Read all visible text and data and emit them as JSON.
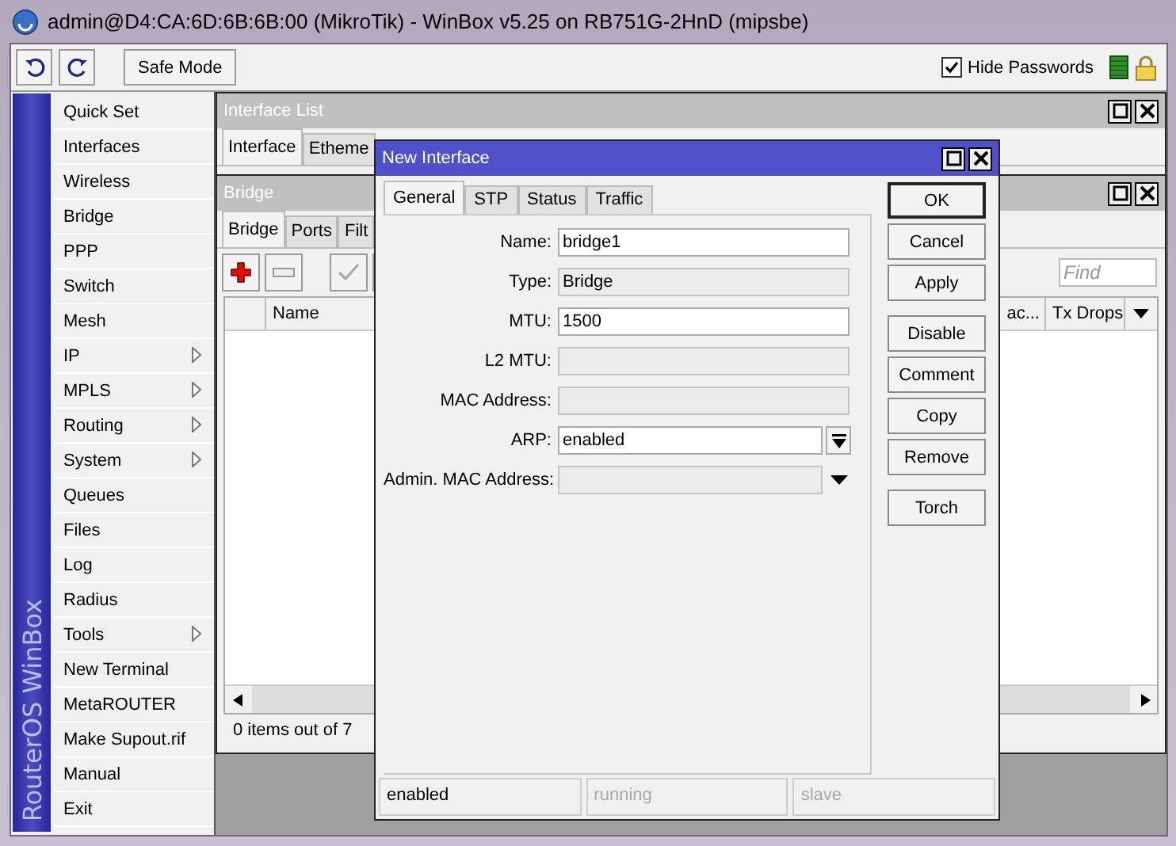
{
  "window": {
    "title": "admin@D4:CA:6D:6B:6B:00 (MikroTik) - WinBox v5.25 on RB751G-2HnD (mipsbe)"
  },
  "toolbar": {
    "safe_mode": "Safe Mode",
    "hide_passwords": {
      "label": "Hide Passwords",
      "checked": true
    }
  },
  "sidebar": {
    "brand": "RouterOS WinBox",
    "items": [
      {
        "label": "Quick Set",
        "submenu": false
      },
      {
        "label": "Interfaces",
        "submenu": false
      },
      {
        "label": "Wireless",
        "submenu": false
      },
      {
        "label": "Bridge",
        "submenu": false
      },
      {
        "label": "PPP",
        "submenu": false
      },
      {
        "label": "Switch",
        "submenu": false
      },
      {
        "label": "Mesh",
        "submenu": false
      },
      {
        "label": "IP",
        "submenu": true
      },
      {
        "label": "MPLS",
        "submenu": true
      },
      {
        "label": "Routing",
        "submenu": true
      },
      {
        "label": "System",
        "submenu": true
      },
      {
        "label": "Queues",
        "submenu": false
      },
      {
        "label": "Files",
        "submenu": false
      },
      {
        "label": "Log",
        "submenu": false
      },
      {
        "label": "Radius",
        "submenu": false
      },
      {
        "label": "Tools",
        "submenu": true
      },
      {
        "label": "New Terminal",
        "submenu": false
      },
      {
        "label": "MetaROUTER",
        "submenu": false
      },
      {
        "label": "Make Supout.rif",
        "submenu": false
      },
      {
        "label": "Manual",
        "submenu": false
      },
      {
        "label": "Exit",
        "submenu": false
      }
    ]
  },
  "interface_list": {
    "title": "Interface List",
    "tabs": [
      {
        "label": "Interface",
        "selected": true
      },
      {
        "label": "Etheme",
        "selected": false
      }
    ]
  },
  "bridge": {
    "title": "Bridge",
    "tabs": [
      {
        "label": "Bridge",
        "selected": true
      },
      {
        "label": "Ports",
        "selected": false
      },
      {
        "label": "Filt",
        "selected": false
      }
    ],
    "find_placeholder": "Find",
    "columns": [
      "Name",
      "ac...",
      "Tx Drops"
    ],
    "status": "0 items out of 7"
  },
  "dialog": {
    "title": "New Interface",
    "tabs": [
      {
        "label": "General",
        "selected": true
      },
      {
        "label": "STP",
        "selected": false
      },
      {
        "label": "Status",
        "selected": false
      },
      {
        "label": "Traffic",
        "selected": false
      }
    ],
    "fields": [
      {
        "label": "Name:",
        "value": "bridge1",
        "kind": "text",
        "disabled": false
      },
      {
        "label": "Type:",
        "value": "Bridge",
        "kind": "text",
        "disabled": true
      },
      {
        "label": "MTU:",
        "value": "1500",
        "kind": "text",
        "disabled": false
      },
      {
        "label": "L2 MTU:",
        "kind": "text",
        "disabled": true
      },
      {
        "label": "MAC Address:",
        "kind": "text",
        "disabled": true
      },
      {
        "label": "ARP:",
        "value": "enabled",
        "kind": "dropdown",
        "disabled": false
      },
      {
        "label": "Admin. MAC Address:",
        "kind": "combo",
        "disabled": true
      }
    ],
    "button_groups": [
      [
        {
          "label": "OK",
          "default": true
        },
        {
          "label": "Cancel",
          "default": false
        },
        {
          "label": "Apply",
          "default": false
        }
      ],
      [
        {
          "label": "Disable",
          "default": false
        },
        {
          "label": "Comment",
          "default": false
        },
        {
          "label": "Copy",
          "default": false
        },
        {
          "label": "Remove",
          "default": false
        }
      ],
      [
        {
          "label": "Torch",
          "default": false
        }
      ]
    ],
    "status": [
      {
        "text": "enabled",
        "disabled": false
      },
      {
        "text": "running",
        "disabled": true
      },
      {
        "text": "slave",
        "disabled": true
      }
    ]
  }
}
